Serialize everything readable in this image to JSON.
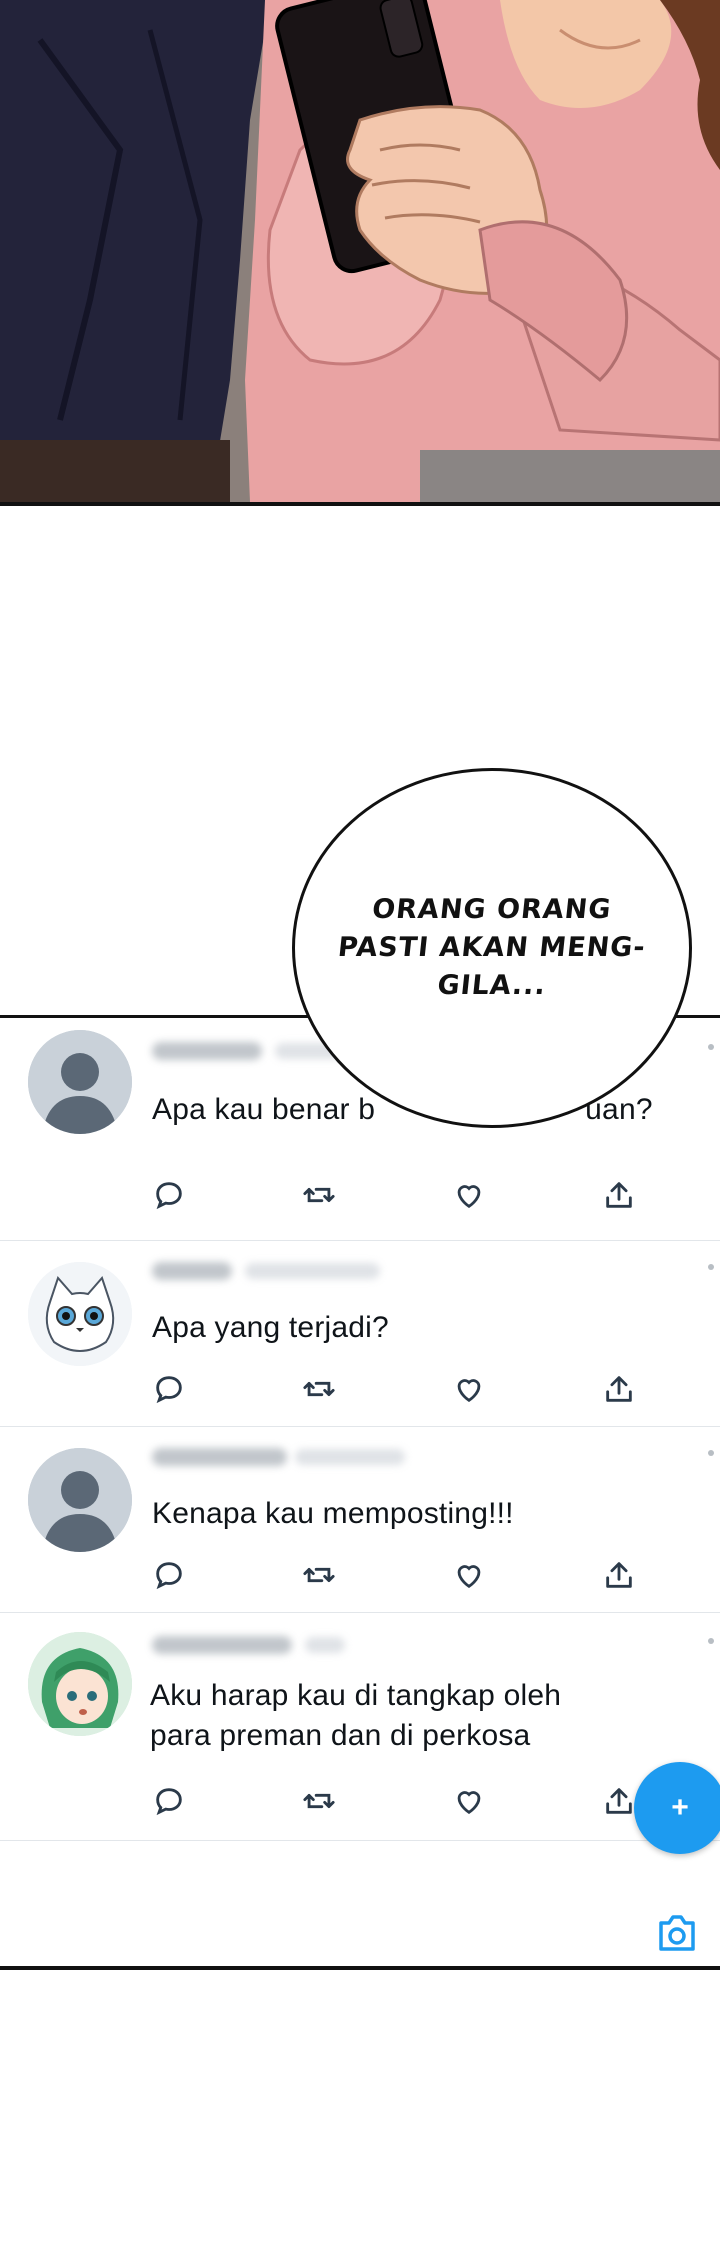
{
  "speech_bubble": {
    "lines": [
      "ORANG ORANG",
      "PASTI AKAN MENG-",
      "GILA..."
    ]
  },
  "feed": {
    "tweets": [
      {
        "text": "Apa kau benar b…              …uan?",
        "text_visible_start": "Apa kau benar b",
        "text_visible_end": "uan?",
        "avatar": "default-avatar"
      },
      {
        "text": "Apa yang terjadi?",
        "avatar": "cat-avatar"
      },
      {
        "text": "Kenapa kau memposting!!!",
        "avatar": "default-avatar"
      },
      {
        "text_lines": [
          "Aku harap kau di tangkap oleh",
          "para preman dan di perkosa"
        ],
        "avatar": "green-hair-avatar"
      }
    ],
    "action_icons": [
      "reply-icon",
      "retweet-icon",
      "like-icon",
      "share-icon"
    ],
    "fab_label": "+",
    "camera_icon": "camera-icon",
    "accent_color": "#1d9bf0"
  }
}
